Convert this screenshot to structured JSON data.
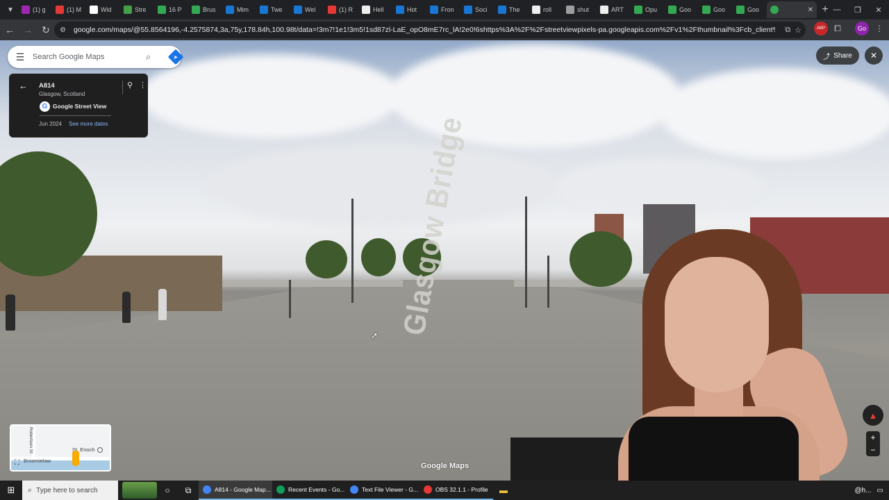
{
  "browser": {
    "tabs": [
      {
        "label": "(1) g",
        "color": "#9c27b0"
      },
      {
        "label": "(1) M",
        "color": "#e53935"
      },
      {
        "label": "Wid",
        "color": "#ffffff"
      },
      {
        "label": "Stre",
        "color": "#43a047"
      },
      {
        "label": "16 P",
        "color": "#34a853"
      },
      {
        "label": "Brus",
        "color": "#34a853"
      },
      {
        "label": "Mim",
        "color": "#1976d2"
      },
      {
        "label": "Twe",
        "color": "#1976d2"
      },
      {
        "label": "Wel",
        "color": "#1976d2"
      },
      {
        "label": "(1) R",
        "color": "#e53935"
      },
      {
        "label": "Hell",
        "color": "#eeeeee"
      },
      {
        "label": "Hot",
        "color": "#1976d2"
      },
      {
        "label": "Fron",
        "color": "#1976d2"
      },
      {
        "label": "Soci",
        "color": "#1976d2"
      },
      {
        "label": "The",
        "color": "#1976d2"
      },
      {
        "label": "roll",
        "color": "#eeeeee"
      },
      {
        "label": "shut",
        "color": "#9e9e9e"
      },
      {
        "label": "ART",
        "color": "#eeeeee"
      },
      {
        "label": "Opu",
        "color": "#34a853"
      },
      {
        "label": "Goo",
        "color": "#34a853"
      },
      {
        "label": "Goo",
        "color": "#34a853"
      },
      {
        "label": "Goo",
        "color": "#34a853"
      }
    ],
    "active_tab_label": "",
    "url": "google.com/maps/@55.8564196,-4.2575874,3a,75y,178.84h,100.98t/data=!3m7!1e1!3m5!1sd87zl-LaE_opO8mE7rc_lA!2e0!6shttps%3A%2F%2Fstreetviewpixels-pa.googleapis.com%2Fv1%2Fthumbnail%3Fcb_client%3Dmaps_sv.tactile%26w%3D900%...",
    "profile_label": "Go",
    "ext_label": "ABP"
  },
  "maps": {
    "search_placeholder": "Search Google Maps",
    "location_title": "A814",
    "location_subtitle": "Glasgow, Scotland",
    "provider": "Google Street View",
    "provider_logo": "G",
    "capture_date": "Jun 2024",
    "see_more_dates": "See more dates",
    "share_label": "Share",
    "road_marking": "Glasgow Bridge",
    "watermark": "Google Maps",
    "minimap": {
      "labels": [
        "Robertson St",
        "St. Enoch",
        "Broomielaw"
      ]
    }
  },
  "taskbar": {
    "search_placeholder": "Type here to search",
    "apps": [
      {
        "label": "A814 - Google Map...",
        "color": "#4285f4",
        "active": true
      },
      {
        "label": "Recent Events - Go...",
        "color": "#0f9d58",
        "active": false
      },
      {
        "label": "Text File Viewer - G...",
        "color": "#4285f4",
        "active": false
      },
      {
        "label": "OBS 32.1.1 - Profile",
        "color": "#e53935",
        "active": false
      }
    ],
    "system_tray": "@h..."
  },
  "icons": {
    "menu": "hamburger-icon",
    "search": "search-icon",
    "directions": "directions-icon",
    "back": "arrow-left-icon",
    "pin": "location-pin-icon",
    "more": "more-vert-icon",
    "share": "share-icon",
    "close": "close-icon",
    "compass": "compass-icon",
    "zoom_in": "plus-icon",
    "zoom_out": "minus-icon",
    "expand": "expand-icon"
  }
}
